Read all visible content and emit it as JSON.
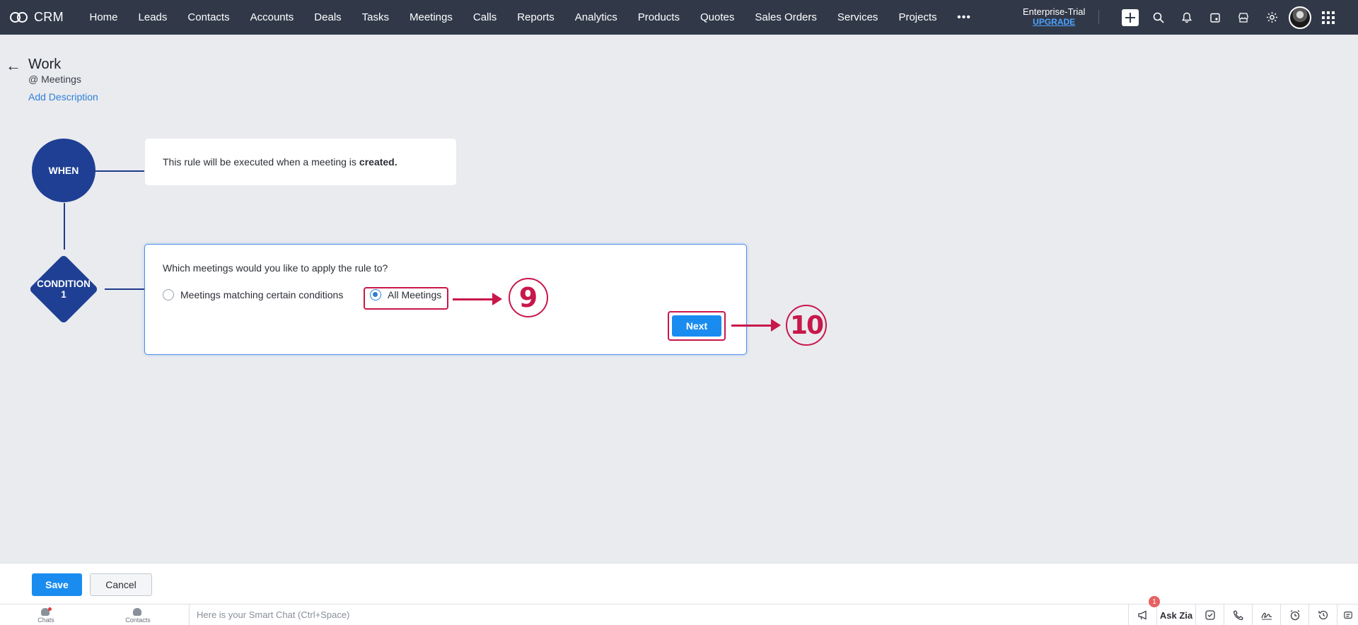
{
  "nav": {
    "brand": "CRM",
    "items": [
      "Home",
      "Leads",
      "Contacts",
      "Accounts",
      "Deals",
      "Tasks",
      "Meetings",
      "Calls",
      "Reports",
      "Analytics",
      "Products",
      "Quotes",
      "Sales Orders",
      "Services",
      "Projects"
    ],
    "more": "•••",
    "edition": "Enterprise-Trial",
    "upgrade": "UPGRADE"
  },
  "header": {
    "back_icon": "←",
    "title": "Work",
    "module_prefix": "@",
    "module": "Meetings",
    "add_description": "Add Description"
  },
  "flow": {
    "when_label": "WHEN",
    "when_text": "This rule will be executed when a meeting is",
    "when_emphasis": "created.",
    "condition_label_line1": "CONDITION",
    "condition_label_line2": "1",
    "question": "Which meetings would you like to apply the rule to?",
    "options": [
      {
        "label": "Meetings matching certain conditions",
        "selected": false
      },
      {
        "label": "All Meetings",
        "selected": true
      }
    ],
    "next_label": "Next"
  },
  "annotations": {
    "step_9": "9",
    "step_10": "10",
    "color": "#c8174a"
  },
  "actions": {
    "save": "Save",
    "cancel": "Cancel"
  },
  "status_bar": {
    "chats": "Chats",
    "contacts": "Contacts",
    "smart_chat_placeholder": "Here is your Smart Chat (Ctrl+Space)",
    "notification_count": "1",
    "ask_zia": "Ask Zia"
  },
  "colors": {
    "topnav": "#313949",
    "flow_node": "#1f3f94",
    "primary_button": "#1a8cf0",
    "link": "#2f7fd8"
  }
}
